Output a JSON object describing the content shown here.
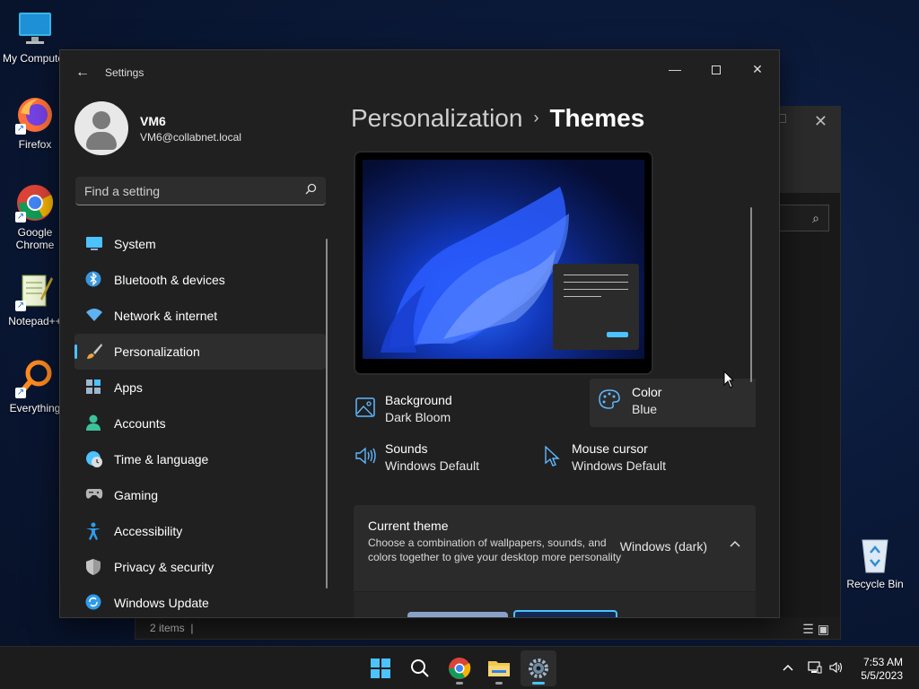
{
  "desktop": {
    "icons": [
      {
        "label": "My Computer",
        "icon": "monitor-icon"
      },
      {
        "label": "Firefox",
        "icon": "firefox-icon"
      },
      {
        "label": "Google Chrome",
        "icon": "chrome-icon"
      },
      {
        "label": "Notepad++",
        "icon": "notepad-plus-plus-icon"
      },
      {
        "label": "Everything",
        "icon": "everything-search-icon"
      },
      {
        "label": "Recycle Bin",
        "icon": "recycle-bin-icon"
      }
    ]
  },
  "explorer": {
    "status_items": "2 items",
    "status_sep": "|"
  },
  "settings": {
    "title": "Settings",
    "profile": {
      "name": "VM6",
      "email": "VM6@collabnet.local"
    },
    "search": {
      "placeholder": "Find a setting"
    },
    "nav": [
      {
        "label": "System",
        "icon": "system-icon",
        "color": "#4cc2ff"
      },
      {
        "label": "Bluetooth & devices",
        "icon": "bluetooth-icon",
        "color": "#3a96dd"
      },
      {
        "label": "Network & internet",
        "icon": "wifi-icon",
        "color": "#5fb2f2"
      },
      {
        "label": "Personalization",
        "icon": "paintbrush-icon",
        "color": "#e8a33d",
        "active": true
      },
      {
        "label": "Apps",
        "icon": "apps-icon",
        "color": "#9fb6cc"
      },
      {
        "label": "Accounts",
        "icon": "accounts-icon",
        "color": "#3cc29a"
      },
      {
        "label": "Time & language",
        "icon": "globe-clock-icon",
        "color": "#4cc2ff"
      },
      {
        "label": "Gaming",
        "icon": "controller-icon",
        "color": "#b5b5b5"
      },
      {
        "label": "Accessibility",
        "icon": "accessibility-icon",
        "color": "#2f9bea"
      },
      {
        "label": "Privacy & security",
        "icon": "shield-icon",
        "color": "#9a9a9a"
      },
      {
        "label": "Windows Update",
        "icon": "update-icon",
        "color": "#2f9bea"
      }
    ],
    "breadcrumb": {
      "parent": "Personalization",
      "separator": "›",
      "current": "Themes"
    },
    "tiles": [
      {
        "name": "Background",
        "value": "Dark Bloom",
        "icon": "picture-icon"
      },
      {
        "name": "Color",
        "value": "Blue",
        "icon": "palette-icon",
        "active": true
      },
      {
        "name": "Sounds",
        "value": "Windows Default",
        "icon": "speaker-icon"
      },
      {
        "name": "Mouse cursor",
        "value": "Windows Default",
        "icon": "cursor-icon"
      }
    ],
    "current_theme": {
      "title": "Current theme",
      "description": "Choose a combination of wallpapers, sounds, and colors together to give your desktop more personality",
      "value": "Windows (dark)"
    },
    "accent_color": "#4cc2ff"
  },
  "taskbar": {
    "apps": [
      "start-icon",
      "search-icon",
      "chrome-icon",
      "file-explorer-icon",
      "settings-gear-icon"
    ],
    "time": "7:53 AM",
    "date": "5/5/2023"
  }
}
